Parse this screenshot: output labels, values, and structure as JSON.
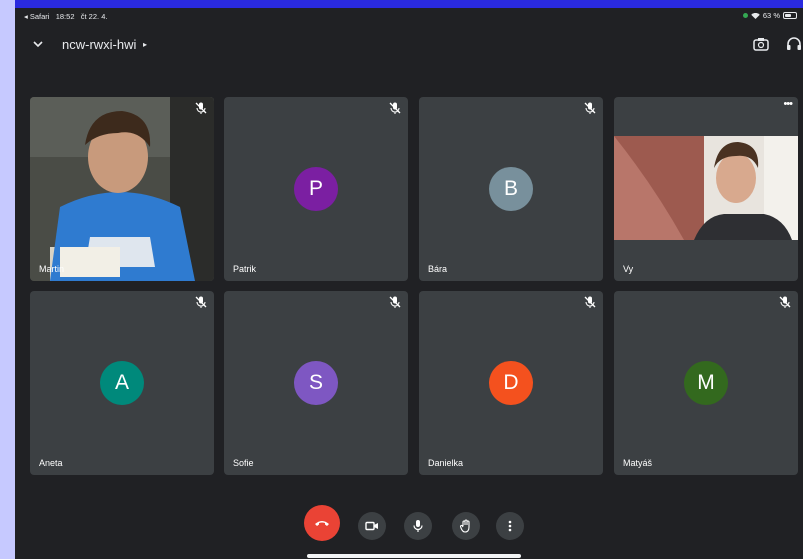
{
  "status_bar": {
    "back_app": "◂ Safari",
    "time": "18:52",
    "date": "čt 22. 4.",
    "battery": "63 %",
    "battery_fraction": 0.63
  },
  "header": {
    "meeting_code": "ncw-rwxi-hwi",
    "caret": "▸"
  },
  "participants": [
    {
      "name": "Martin",
      "type": "video",
      "muted": true
    },
    {
      "name": "Patrik",
      "type": "avatar",
      "initial": "P",
      "color": "#7b1fa2",
      "muted": true
    },
    {
      "name": "Bára",
      "type": "avatar",
      "initial": "B",
      "color": "#78909c",
      "muted": true
    },
    {
      "name": "Vy",
      "type": "video",
      "muted": false,
      "more": "•••"
    },
    {
      "name": "Aneta",
      "type": "avatar",
      "initial": "A",
      "color": "#00897b",
      "muted": true
    },
    {
      "name": "Sofie",
      "type": "avatar",
      "initial": "S",
      "color": "#7e57c2",
      "muted": true
    },
    {
      "name": "Danielka",
      "type": "avatar",
      "initial": "D",
      "color": "#f4511e",
      "muted": true
    },
    {
      "name": "Matyáš",
      "type": "avatar",
      "initial": "M",
      "color": "#33691e",
      "muted": true
    }
  ],
  "controls": [
    "end-call",
    "camera",
    "microphone",
    "raise-hand",
    "more-options"
  ],
  "colors": {
    "background": "#202124",
    "tile": "#3c4043",
    "end_call": "#ea4335"
  }
}
